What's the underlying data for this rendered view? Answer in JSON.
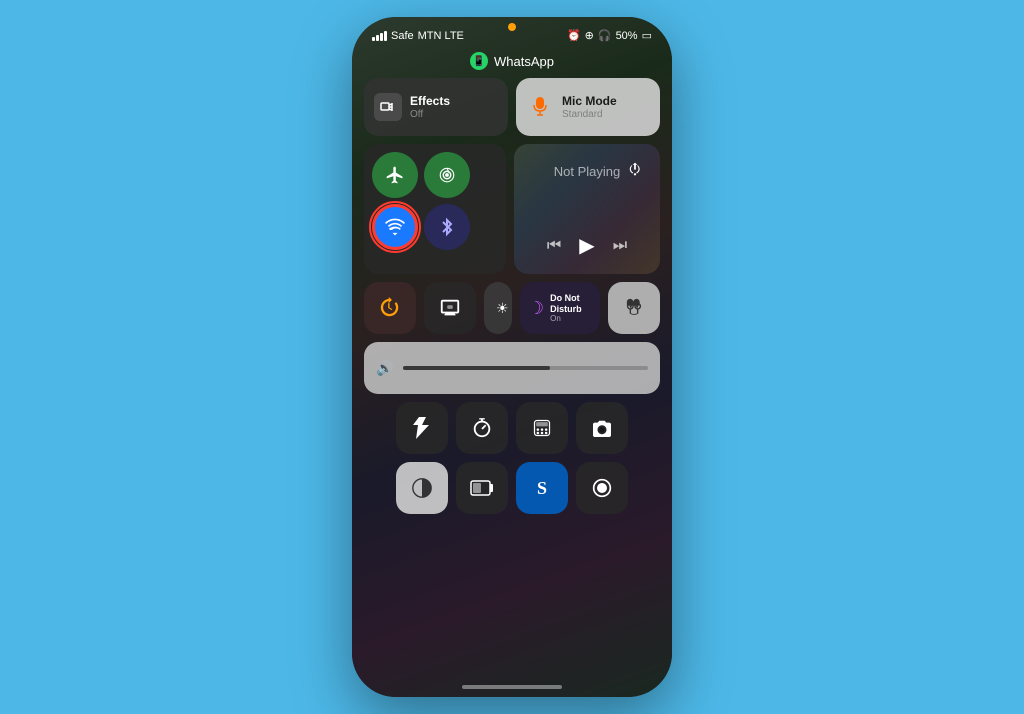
{
  "phone": {
    "top_indicator_color": "#ff9f0a",
    "status": {
      "carrier": "Safe",
      "network": "MTN LTE",
      "battery": "50%"
    },
    "app_name": "WhatsApp"
  },
  "controls": {
    "effects": {
      "label": "Effects",
      "sublabel": "Off"
    },
    "mic_mode": {
      "label": "Mic Mode",
      "sublabel": "Standard"
    },
    "now_playing": {
      "label": "Not Playing"
    },
    "do_not_disturb": {
      "label": "Do Not Disturb",
      "sublabel": "On"
    },
    "connectivity": {
      "airplane": "✈",
      "cellular": "📶",
      "wifi": "wifi",
      "bluetooth": "bluetooth"
    }
  },
  "icons": {
    "airplane": "✈",
    "wifi": "wifi",
    "bluetooth": "B",
    "cellular": "●",
    "moon": "☽",
    "sun": "☀",
    "flashlight": "🔦",
    "timer": "⏱",
    "calculator": "⌨",
    "camera": "📷",
    "invert": "◑",
    "battery": "▭",
    "shazam": "S",
    "record": "⏺",
    "rotation": "🔒",
    "mirror": "⊟",
    "airpods": "🎧",
    "airplay": "⬆",
    "rewind": "⏮",
    "play": "▶",
    "forward": "⏭"
  }
}
